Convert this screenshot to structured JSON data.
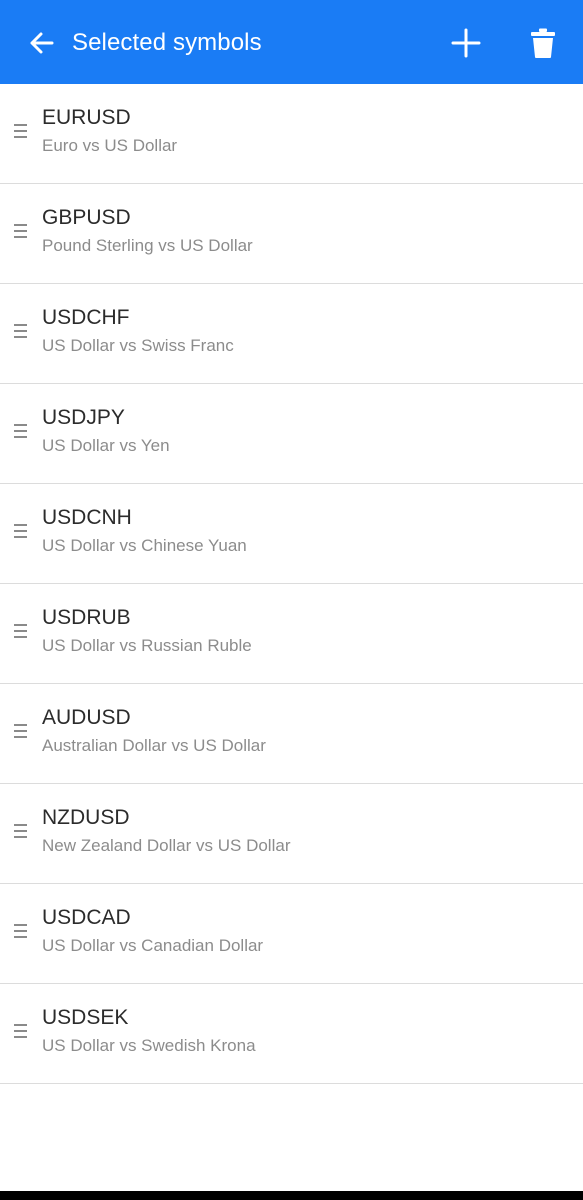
{
  "app_bar": {
    "title": "Selected symbols",
    "background_color": "#1a7cf5",
    "back_icon": "arrow-left-icon",
    "add_icon": "plus-icon",
    "delete_icon": "trash-icon"
  },
  "symbols": [
    {
      "code": "EURUSD",
      "description": "Euro vs US Dollar"
    },
    {
      "code": "GBPUSD",
      "description": "Pound Sterling vs US Dollar"
    },
    {
      "code": "USDCHF",
      "description": "US Dollar vs Swiss Franc"
    },
    {
      "code": "USDJPY",
      "description": "US Dollar vs Yen"
    },
    {
      "code": "USDCNH",
      "description": "US Dollar vs Chinese Yuan"
    },
    {
      "code": "USDRUB",
      "description": "US Dollar vs Russian Ruble"
    },
    {
      "code": "AUDUSD",
      "description": "Australian Dollar vs US Dollar"
    },
    {
      "code": "NZDUSD",
      "description": "New Zealand Dollar vs US Dollar"
    },
    {
      "code": "USDCAD",
      "description": "US Dollar vs Canadian Dollar"
    },
    {
      "code": "USDSEK",
      "description": "US Dollar vs Swedish Krona"
    }
  ],
  "row_handle_icon": "drag-handle-icon"
}
